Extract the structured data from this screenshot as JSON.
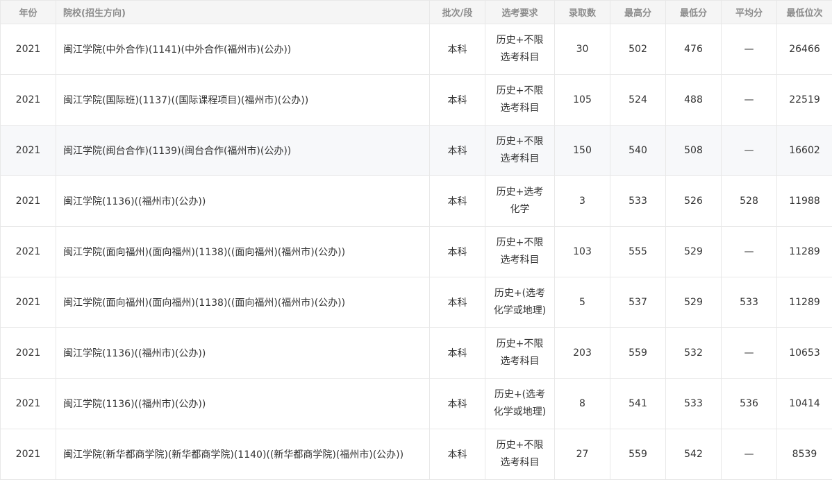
{
  "columns": {
    "year": "年份",
    "school": "院校(招生方向)",
    "batch": "批次/段",
    "subjects": "选考要求",
    "admitted": "录取数",
    "max_score": "最高分",
    "min_score": "最低分",
    "avg_score": "平均分",
    "min_rank": "最低位次"
  },
  "rows": [
    {
      "year": "2021",
      "school": "闽江学院(中外合作)(1141)(中外合作(福州市)(公办))",
      "batch": "本科",
      "subjects": "历史+不限选考科目",
      "admitted": "30",
      "max_score": "502",
      "min_score": "476",
      "avg_score": "—",
      "min_rank": "26466"
    },
    {
      "year": "2021",
      "school": "闽江学院(国际班)(1137)((国际课程项目)(福州市)(公办))",
      "batch": "本科",
      "subjects": "历史+不限选考科目",
      "admitted": "105",
      "max_score": "524",
      "min_score": "488",
      "avg_score": "—",
      "min_rank": "22519"
    },
    {
      "year": "2021",
      "school": "闽江学院(闽台合作)(1139)(闽台合作(福州市)(公办))",
      "batch": "本科",
      "subjects": "历史+不限选考科目",
      "admitted": "150",
      "max_score": "540",
      "min_score": "508",
      "avg_score": "—",
      "min_rank": "16602"
    },
    {
      "year": "2021",
      "school": "闽江学院(1136)((福州市)(公办))",
      "batch": "本科",
      "subjects": "历史+选考化学",
      "admitted": "3",
      "max_score": "533",
      "min_score": "526",
      "avg_score": "528",
      "min_rank": "11988"
    },
    {
      "year": "2021",
      "school": "闽江学院(面向福州)(面向福州)(1138)((面向福州)(福州市)(公办))",
      "batch": "本科",
      "subjects": "历史+不限选考科目",
      "admitted": "103",
      "max_score": "555",
      "min_score": "529",
      "avg_score": "—",
      "min_rank": "11289"
    },
    {
      "year": "2021",
      "school": "闽江学院(面向福州)(面向福州)(1138)((面向福州)(福州市)(公办))",
      "batch": "本科",
      "subjects": "历史+(选考化学或地理)",
      "admitted": "5",
      "max_score": "537",
      "min_score": "529",
      "avg_score": "533",
      "min_rank": "11289"
    },
    {
      "year": "2021",
      "school": "闽江学院(1136)((福州市)(公办))",
      "batch": "本科",
      "subjects": "历史+不限选考科目",
      "admitted": "203",
      "max_score": "559",
      "min_score": "532",
      "avg_score": "—",
      "min_rank": "10653"
    },
    {
      "year": "2021",
      "school": "闽江学院(1136)((福州市)(公办))",
      "batch": "本科",
      "subjects": "历史+(选考化学或地理)",
      "admitted": "8",
      "max_score": "541",
      "min_score": "533",
      "avg_score": "536",
      "min_rank": "10414"
    },
    {
      "year": "2021",
      "school": "闽江学院(新华都商学院)(新华都商学院)(1140)((新华都商学院)(福州市)(公办))",
      "batch": "本科",
      "subjects": "历史+不限选考科目",
      "admitted": "27",
      "max_score": "559",
      "min_score": "542",
      "avg_score": "—",
      "min_rank": "8539"
    }
  ]
}
